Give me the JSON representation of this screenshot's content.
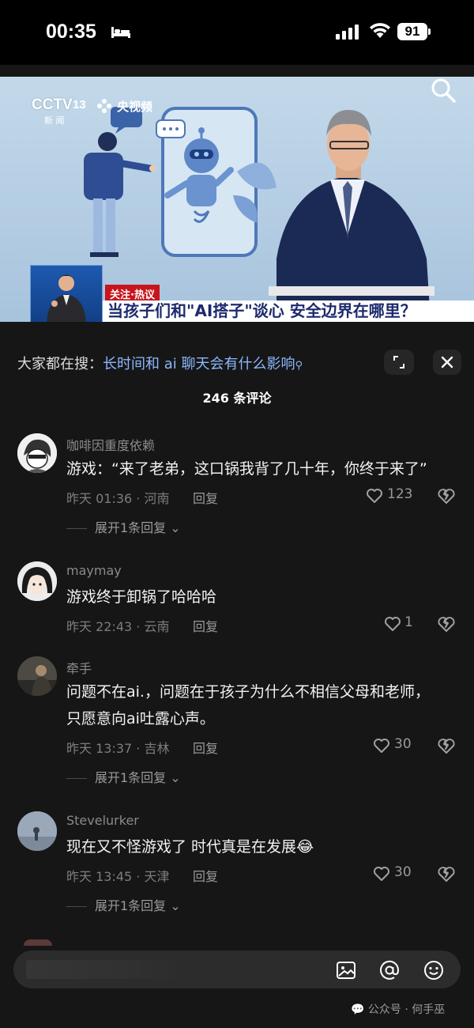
{
  "status_bar": {
    "time": "00:35",
    "battery": "91"
  },
  "video": {
    "cctv_logo": "CCTV",
    "cctv_channel": "13",
    "cctv_sub": "新 闻",
    "yangshipin": "央视频",
    "tag": "关注·热议",
    "headline": "当孩子们和\"AI搭子\"谈心 安全边界在哪里？"
  },
  "panel": {
    "search_prefix": "大家都在搜：",
    "search_query": "长时间和 ai 聊天会有什么影响",
    "comment_count": "246 条评论"
  },
  "comments": [
    {
      "user": "咖啡因重度依赖",
      "text": "游戏：“来了老弟，这口锅我背了几十年，你终于来了”",
      "meta": "昨天 01:36 · 河南",
      "reply": "回复",
      "likes": "123",
      "expand": "展开1条回复"
    },
    {
      "user": "maymay",
      "text": "游戏终于卸锅了哈哈哈",
      "meta": "昨天 22:43 · 云南",
      "reply": "回复",
      "likes": "1"
    },
    {
      "user": "牵手",
      "text": "问题不在ai.，问题在于孩子为什么不相信父母和老师，只愿意向ai吐露心声。",
      "meta": "昨天 13:37 · 吉林",
      "reply": "回复",
      "likes": "30",
      "expand": "展开1条回复"
    },
    {
      "user": "Stevelurker",
      "text": "现在又不怪游戏了 时代真是在发展😂",
      "meta": "昨天 13:45 · 天津",
      "reply": "回复",
      "likes": "30",
      "expand": "展开1条回复"
    }
  ],
  "watermark": "公众号 · 何手巫",
  "colors": {
    "accent_link": "#8bb8ff",
    "background": "#161616",
    "headline_text": "#1c2a6c",
    "tag_red": "#c8141c"
  }
}
